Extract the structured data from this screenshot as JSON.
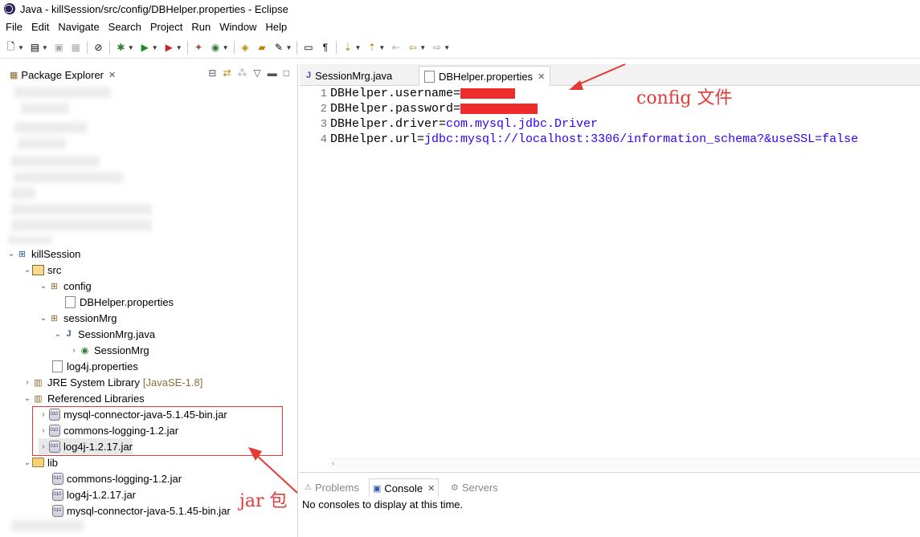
{
  "window": {
    "title": "Java - killSession/src/config/DBHelper.properties - Eclipse"
  },
  "menu": [
    "File",
    "Edit",
    "Navigate",
    "Search",
    "Project",
    "Run",
    "Window",
    "Help"
  ],
  "package_explorer": {
    "title": "Package Explorer",
    "tree": {
      "project": "killSession",
      "src": "src",
      "pkg_config": "config",
      "file_dbhelper": "DBHelper.properties",
      "pkg_sessionmrg": "sessionMrg",
      "file_sessionmrg_java": "SessionMrg.java",
      "class_sessionmrg": "SessionMrg",
      "file_log4j_props": "log4j.properties",
      "jre": "JRE System Library",
      "jre_deco": "[JavaSE-1.8]",
      "ref_libs": "Referenced Libraries",
      "ref_jar1": "mysql-connector-java-5.1.45-bin.jar",
      "ref_jar2": "commons-logging-1.2.jar",
      "ref_jar3": "log4j-1.2.17.jar",
      "lib": "lib",
      "lib_jar1": "commons-logging-1.2.jar",
      "lib_jar2": "log4j-1.2.17.jar",
      "lib_jar3": "mysql-connector-java-5.1.45-bin.jar"
    }
  },
  "editor": {
    "tabs": [
      {
        "label": "SessionMrg.java",
        "active": false
      },
      {
        "label": "DBHelper.properties",
        "active": true
      }
    ],
    "lines": [
      {
        "num": "1",
        "key": "DBHelper.username=",
        "value": ""
      },
      {
        "num": "2",
        "key": "DBHelper.password=",
        "value": ""
      },
      {
        "num": "3",
        "key": "DBHelper.driver=",
        "value": "com.mysql.jdbc.Driver"
      },
      {
        "num": "4",
        "key": "DBHelper.url=",
        "value": "jdbc:mysql://localhost:3306/information_schema?&useSSL=false"
      }
    ]
  },
  "bottom": {
    "tabs": [
      {
        "label": "Problems"
      },
      {
        "label": "Console"
      },
      {
        "label": "Servers"
      }
    ],
    "console_message": "No consoles to display at this time."
  },
  "annotations": {
    "config": "config 文件",
    "jar": "jar 包",
    "color": "#e53935"
  }
}
